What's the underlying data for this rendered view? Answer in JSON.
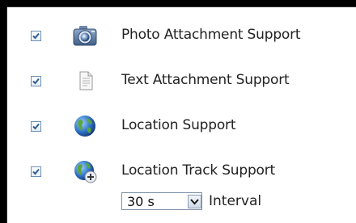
{
  "features": [
    {
      "label": "Photo Attachment Support",
      "checked": true,
      "icon": "camera-icon"
    },
    {
      "label": "Text Attachment Support",
      "checked": true,
      "icon": "document-icon"
    },
    {
      "label": "Location Support",
      "checked": true,
      "icon": "globe-icon"
    },
    {
      "label": "Location Track Support",
      "checked": true,
      "icon": "globe-add-icon"
    }
  ],
  "track_interval": {
    "value": "30 s",
    "label": "Interval"
  },
  "colors": {
    "check": "#2f5f8f",
    "background": "#000000",
    "panel": "#ffffff"
  }
}
